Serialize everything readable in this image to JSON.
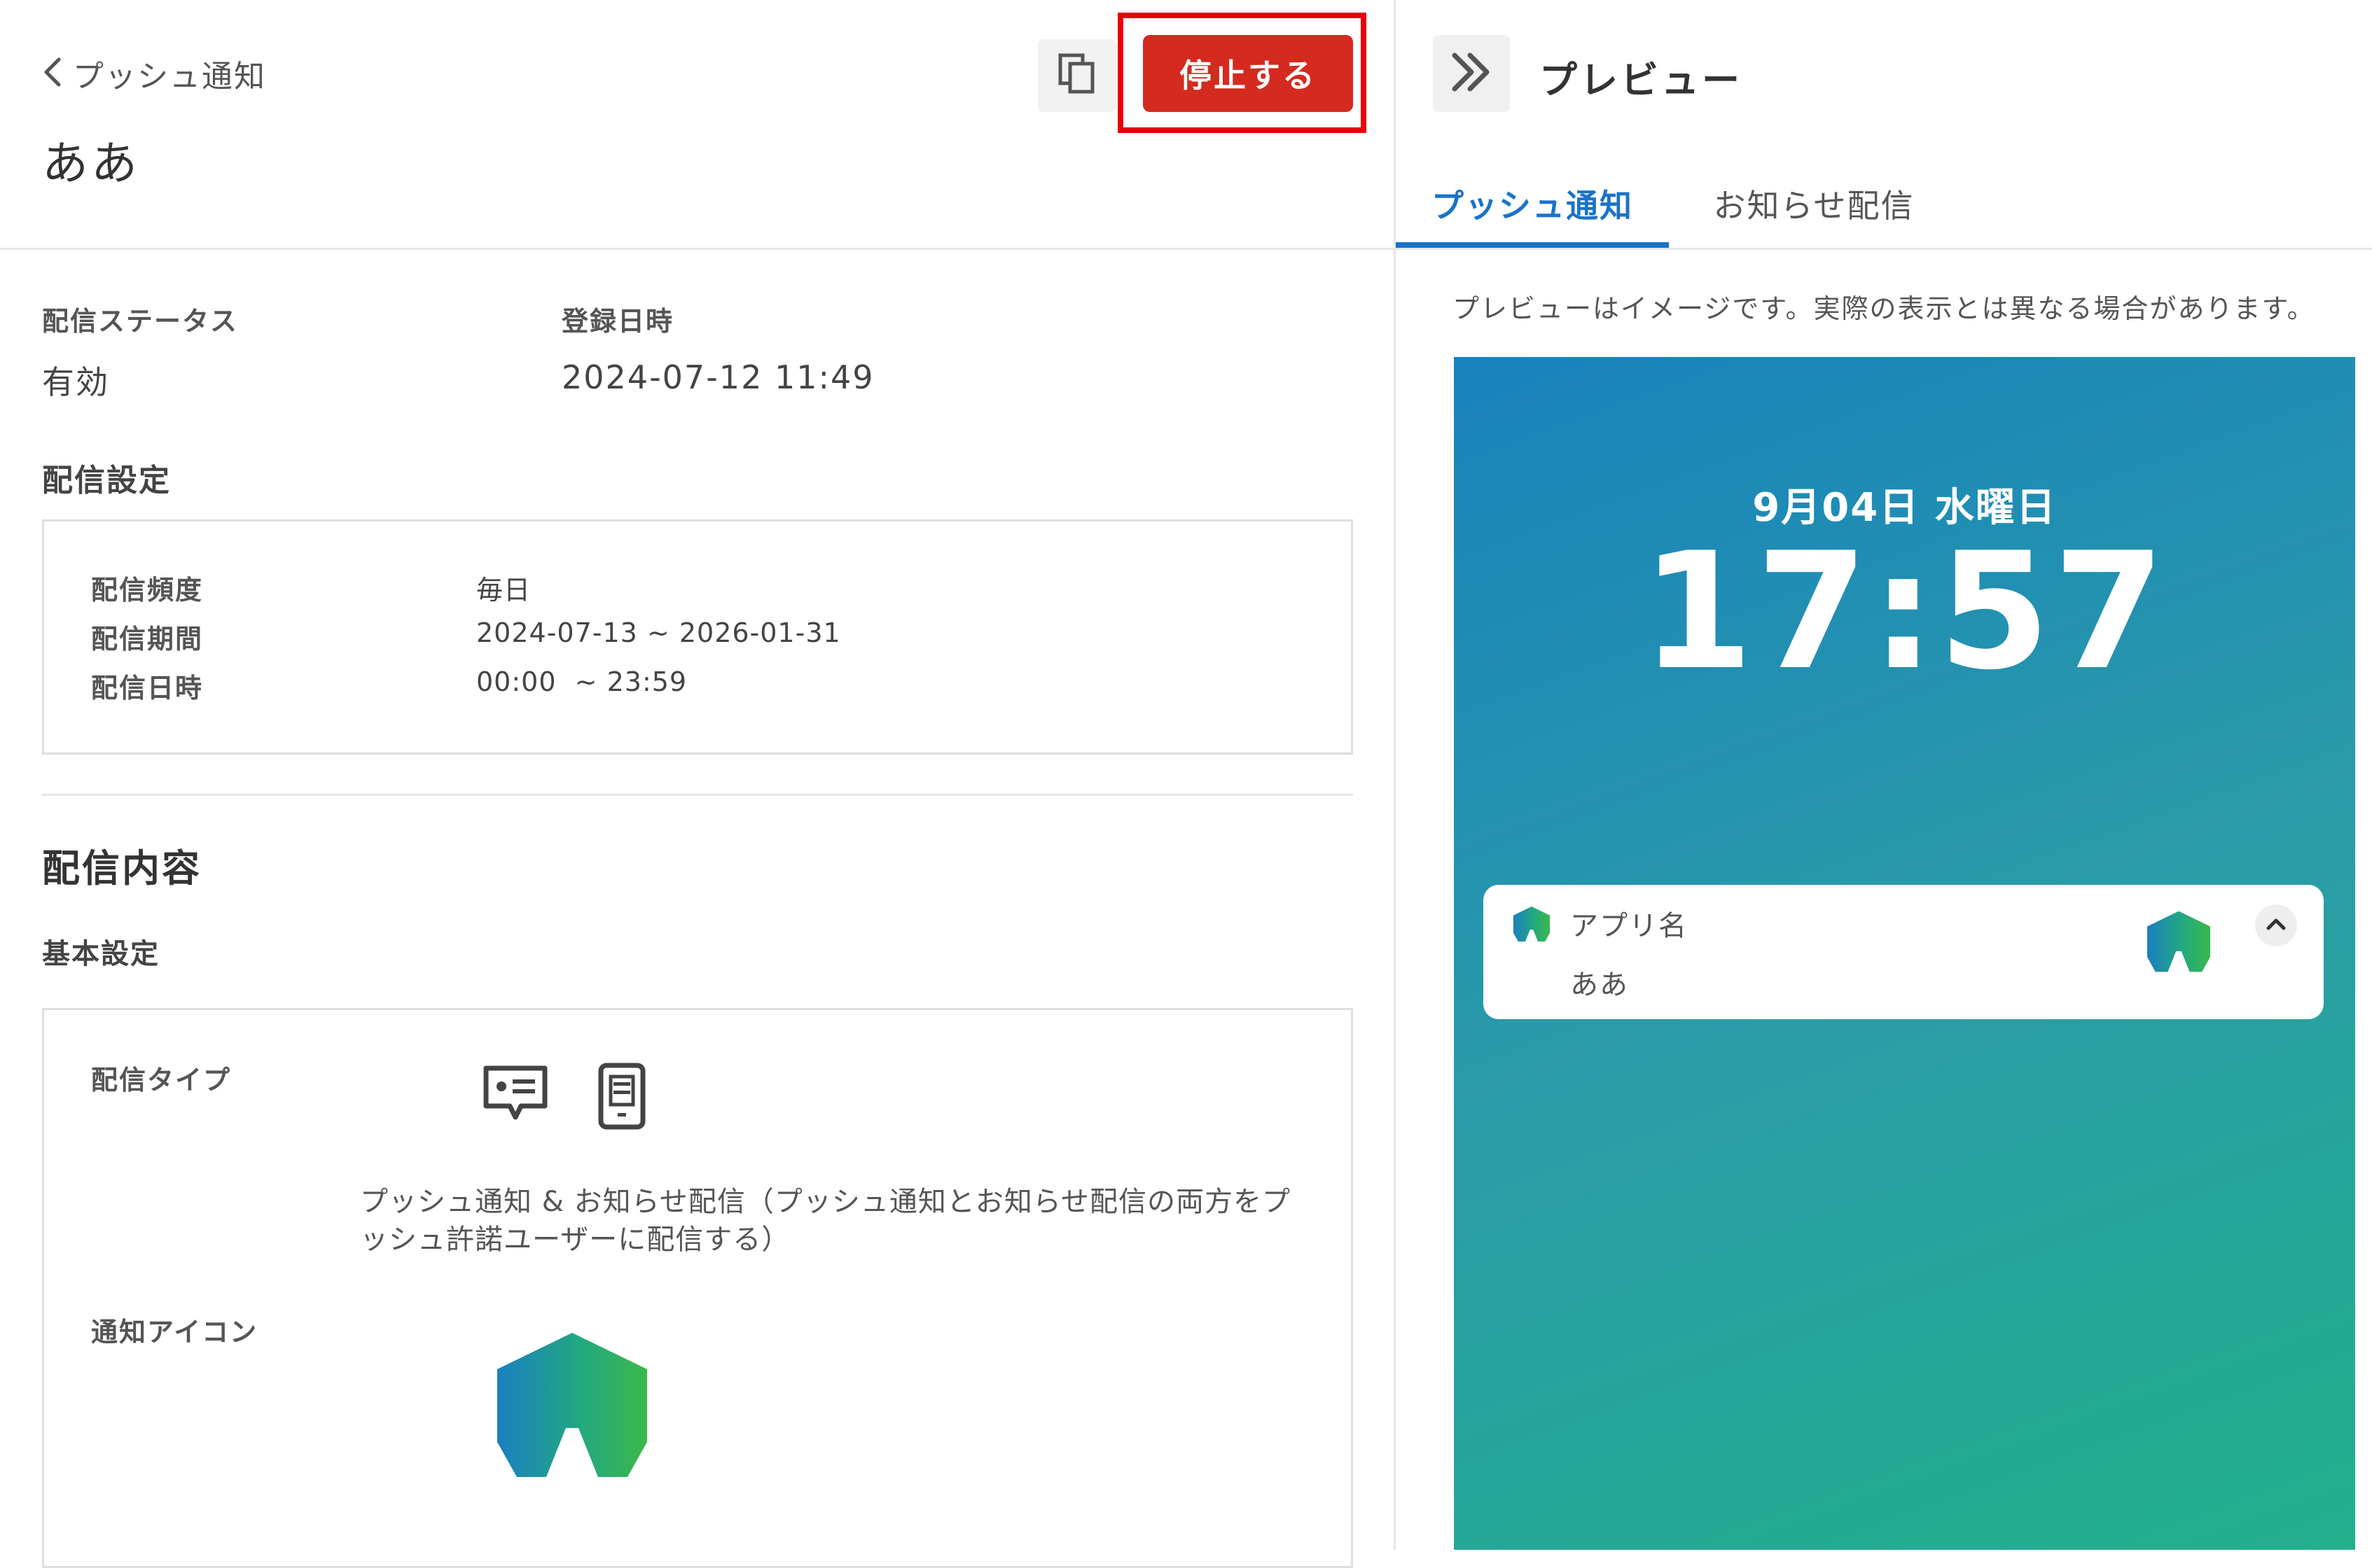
{
  "header": {
    "back_label": "プッシュ通知",
    "title": "ああ",
    "stop_button_label": "停止する"
  },
  "status": {
    "delivery_status_label": "配信ステータス",
    "delivery_status_value": "有効",
    "registered_label": "登録日時",
    "registered_value": "2024-07-12 11:49"
  },
  "delivery_settings": {
    "heading": "配信設定",
    "rows": [
      {
        "label": "配信頻度",
        "value": "毎日"
      },
      {
        "label": "配信期間",
        "value": "2024-07-13 ~ 2026-01-31"
      },
      {
        "label": "配信日時",
        "value": "00:00  ~ 23:59"
      }
    ]
  },
  "content": {
    "heading": "配信内容",
    "basic_settings_label": "基本設定",
    "type_label": "配信タイプ",
    "type_icons": [
      "message-icon",
      "phone-icon"
    ],
    "type_description": "プッシュ通知 & お知らせ配信（プッシュ通知とお知らせ配信の両方をプッシュ許諾ユーザーに配信する）",
    "icon_label": "通知アイコン"
  },
  "preview": {
    "title": "プレビュー",
    "tabs": [
      {
        "label": "プッシュ通知",
        "active": true
      },
      {
        "label": "お知らせ配信",
        "active": false
      }
    ],
    "note": "プレビューはイメージです。実際の表示とは異なる場合があります。",
    "lock_date": "9月04日 水曜日",
    "lock_time": "17:57",
    "notification": {
      "app_name": "アプリ名",
      "message": "ああ"
    }
  },
  "colors": {
    "stop_button": "#d42a1f",
    "highlight": "#e8000b",
    "active_tab": "#1a73c8",
    "gradient_start": "#1882bd",
    "gradient_end": "#22b08c"
  }
}
